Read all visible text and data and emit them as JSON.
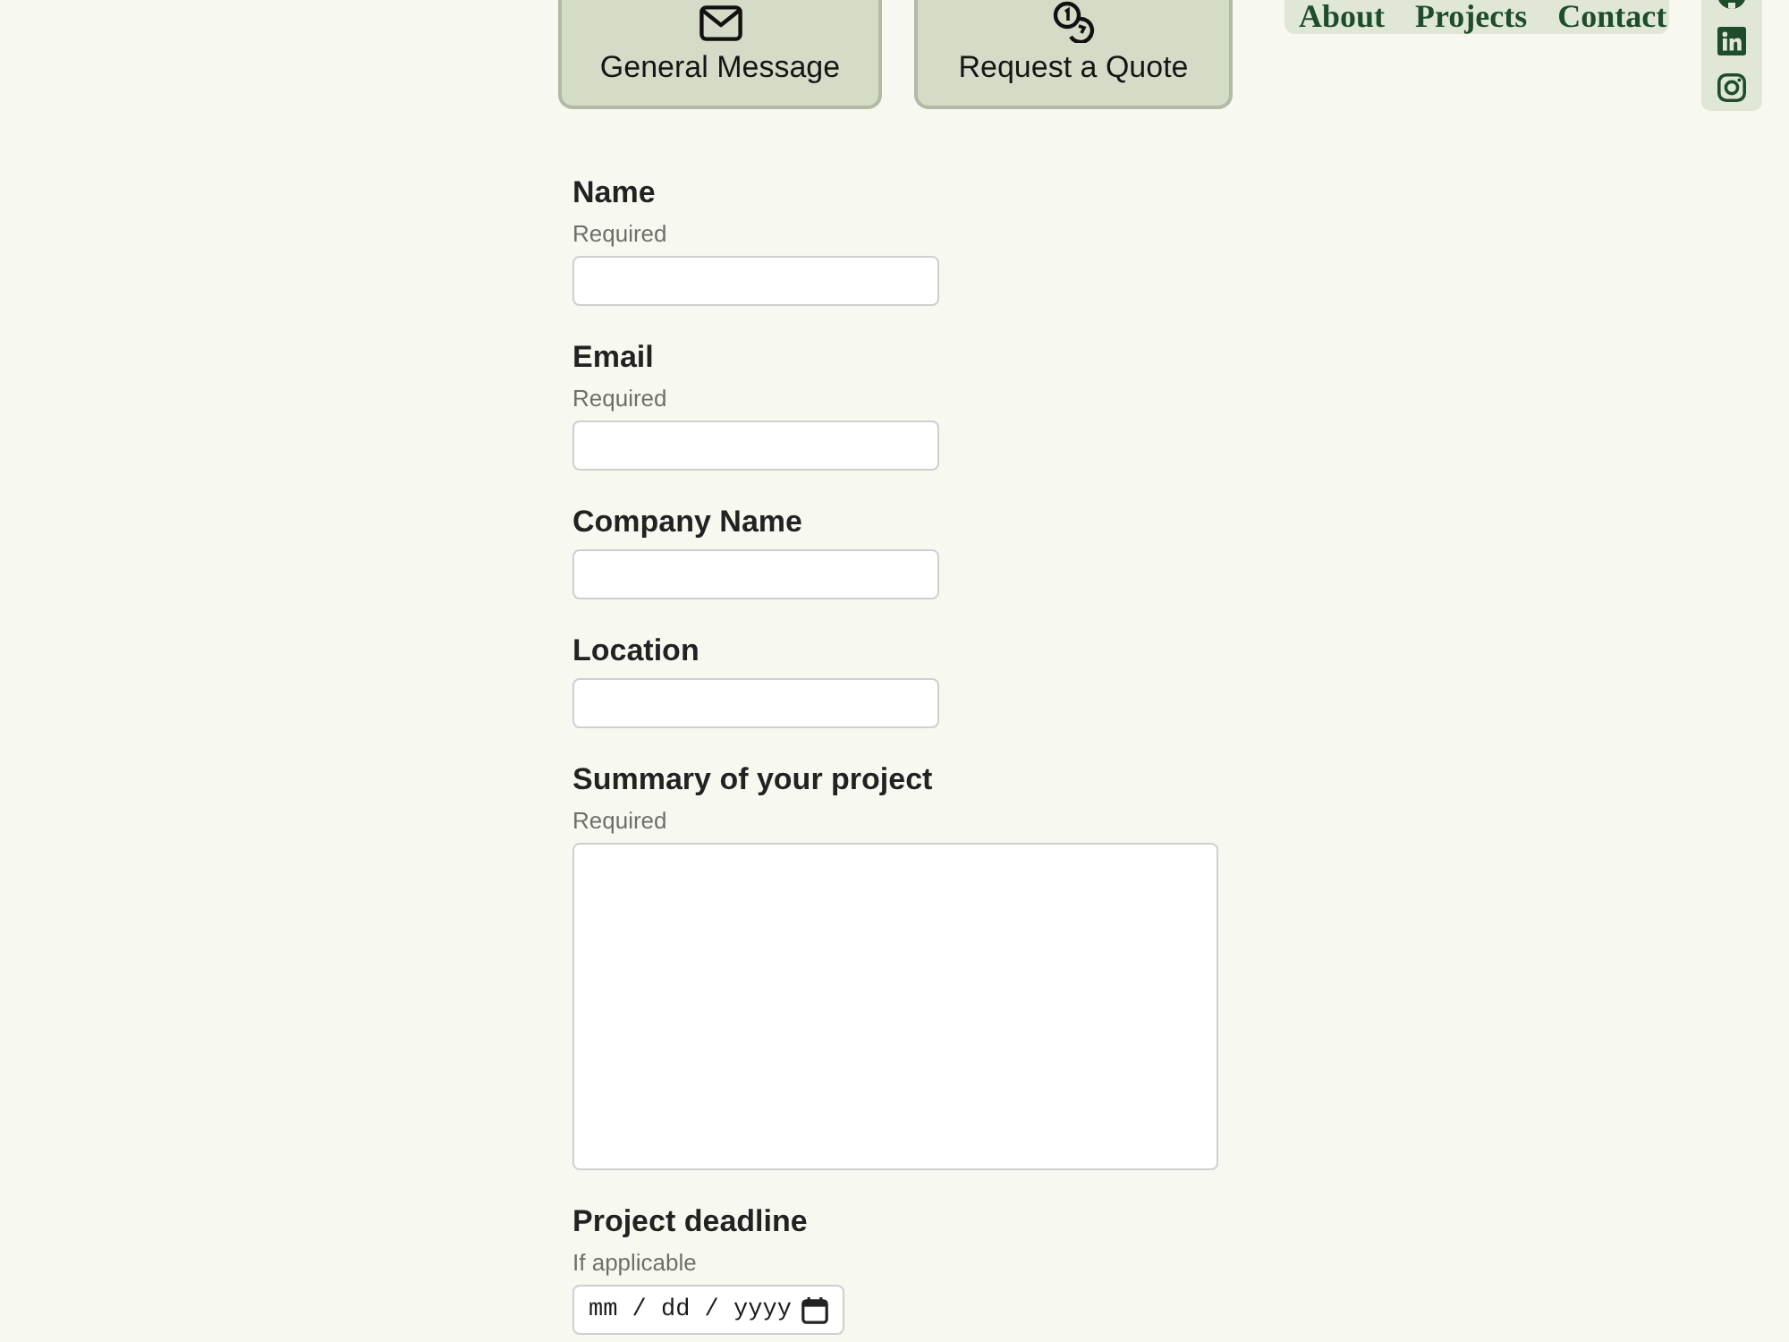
{
  "message_types": [
    {
      "label": "General Message"
    },
    {
      "label": "Request a Quote"
    }
  ],
  "nav": {
    "links": [
      {
        "label": "About"
      },
      {
        "label": "Projects"
      },
      {
        "label": "Contact"
      }
    ]
  },
  "form": {
    "fields": [
      {
        "kind": "text",
        "label": "Name",
        "hint": "Required"
      },
      {
        "kind": "text",
        "label": "Email",
        "hint": "Required"
      },
      {
        "kind": "text",
        "label": "Company Name"
      },
      {
        "kind": "text",
        "label": "Location"
      },
      {
        "kind": "textarea",
        "label": "Summary of your project",
        "hint": "Required"
      },
      {
        "kind": "date",
        "label": "Project deadline",
        "hint": "If applicable",
        "placeholder": "mm / dd / yyyy"
      }
    ]
  }
}
